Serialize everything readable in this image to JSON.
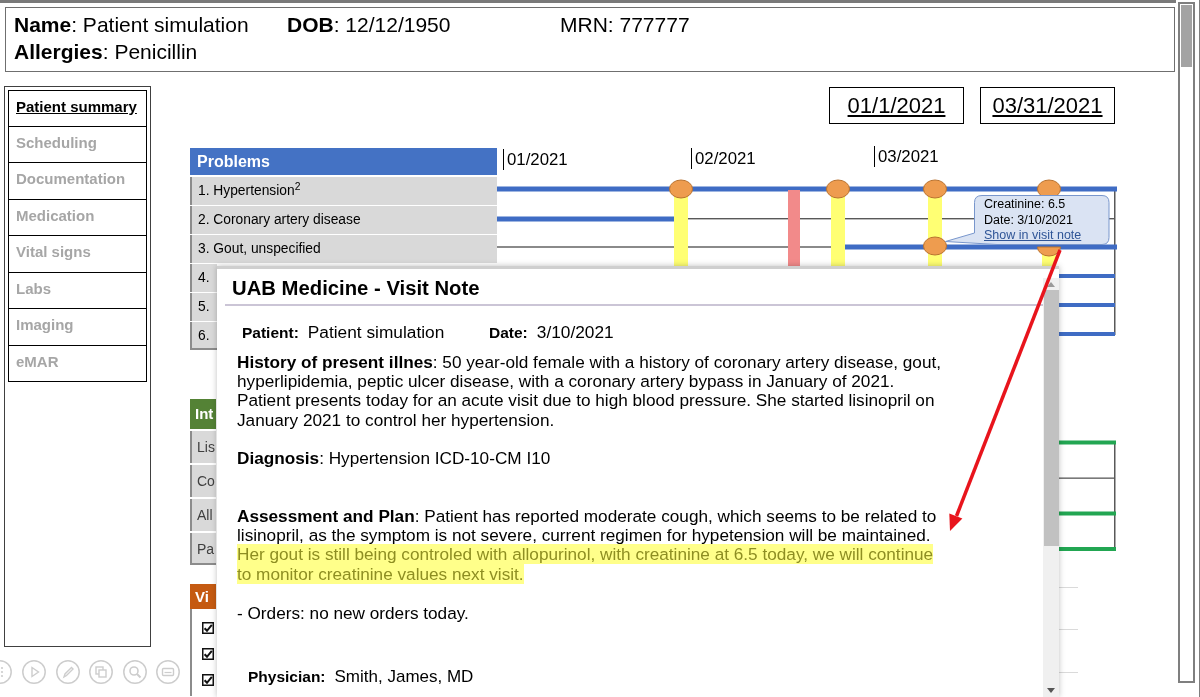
{
  "header": {
    "fields": [
      "**Name**: Patient simulation",
      "**DOB**: 12/12/1950",
      "MRN: 777777"
    ],
    "allergies": "**Allergies**: Penicillin"
  },
  "sidebar": {
    "items": [
      {
        "label": "Patient summary",
        "selected": true
      },
      {
        "label": "Scheduling",
        "selected": false
      },
      {
        "label": "Documentation",
        "selected": false
      },
      {
        "label": "Medication",
        "selected": false
      },
      {
        "label": "Vital signs",
        "selected": false
      },
      {
        "label": "Labs",
        "selected": false
      },
      {
        "label": "Imaging",
        "selected": false
      },
      {
        "label": "eMAR",
        "selected": false
      }
    ]
  },
  "date_range": {
    "start": "01/1/2021",
    "end": "03/31/2021"
  },
  "problems": {
    "title": "Problems",
    "rows": [
      "1. Hypertension$^{2}$",
      "2. Coronary artery disease",
      "3. Gout, unspecified",
      "4.",
      "5.",
      "6."
    ]
  },
  "timeline": {
    "months": [
      "01/2021",
      "02/2021",
      "03/2021"
    ]
  },
  "tooltip": {
    "lines": [
      "Creatinine: 6.5",
      "Date: 3/10/2021"
    ],
    "link": "Show in visit note"
  },
  "interventions": {
    "title": "Int",
    "rows": [
      "Lis",
      "Co",
      "All",
      "Pa"
    ]
  },
  "vitals": {
    "title": "Vi",
    "rows": [
      {
        "checked": true
      },
      {
        "checked": true
      },
      {
        "checked": true
      }
    ]
  },
  "visit_note": {
    "title": "UAB Medicine - Visit Note",
    "patient_label": "Patient:",
    "patient": "Patient simulation",
    "date_label": "Date:",
    "date": "3/10/2021",
    "history": "**History of present illnes**: 50 year-old female with a history of coronary artery disease, gout, hyperlipidemia, peptic ulcer disease, with a coronary artery bypass in January of 2021.\nPatient presents today for an acute visit due to high blood pressure. She started lisinopril on January 2021 to control her hypertension.",
    "diagnosis": "**Diagnosis**: Hypertension ICD-10-CM I10",
    "assessment": "**Assessment and Plan**: Patient has reported moderate cough, which seems to be related to lisinopril, as the symptom is not severe, current regimen for hypetension will be maintained.",
    "assessment_highlight": "Her gout is still being controled with allopurinol, with creatinine at 6.5 today, we will continue to monitor creatinine values next visit.",
    "orders": "- Orders: no new orders today.",
    "physician_label": "Physician:",
    "physician": "Smith, James, MD"
  }
}
